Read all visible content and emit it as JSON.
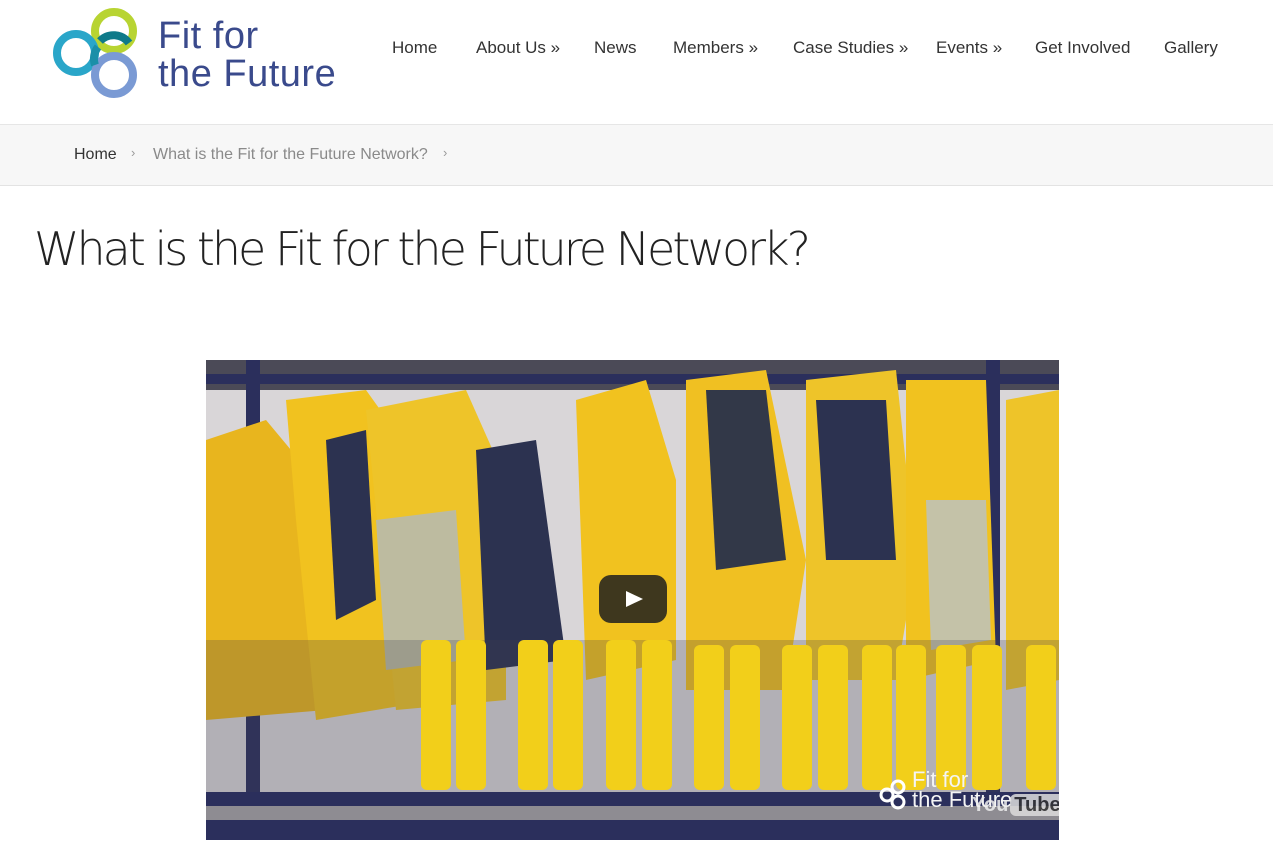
{
  "brand": {
    "line1": "Fit for",
    "line2": "the Future",
    "color": "#3a4a8c",
    "ring_colors": [
      "#b8d432",
      "#2aa6c9",
      "#0f7a8a",
      "#7a9ad4"
    ]
  },
  "nav": {
    "items": [
      {
        "label": "Home"
      },
      {
        "label": "About Us »"
      },
      {
        "label": "News"
      },
      {
        "label": "Members »"
      },
      {
        "label": "Case Studies »"
      },
      {
        "label": "Events »"
      },
      {
        "label": "Get Involved"
      },
      {
        "label": "Gallery"
      }
    ]
  },
  "breadcrumb": {
    "home": "Home",
    "current": "What is the Fit for the Future Network?",
    "separator": "›"
  },
  "page": {
    "title": "What is the Fit for the Future Network?"
  },
  "video": {
    "play_icon": "play-icon",
    "watermark_line1": "Fit for",
    "watermark_line2": "the Future",
    "youtube_you": "You",
    "youtube_tube": "Tube"
  }
}
